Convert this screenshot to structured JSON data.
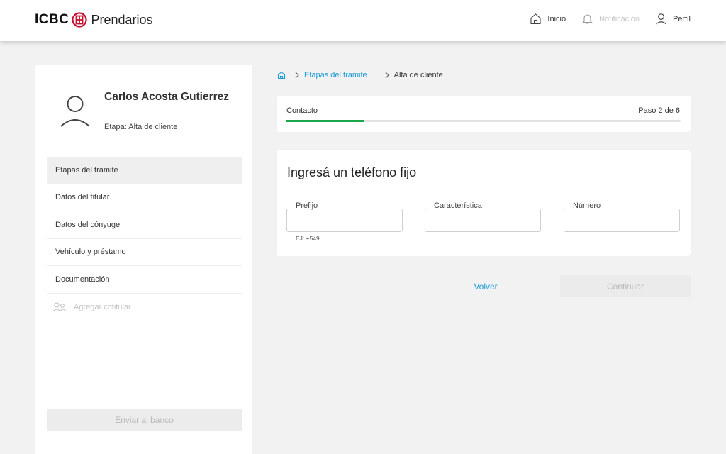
{
  "header": {
    "brand": "ICBC",
    "product": "Prendarios",
    "nav": {
      "home": "Inicio",
      "notifications": "Notificación",
      "profile": "Perfil"
    }
  },
  "sidebar": {
    "user_name": "Carlos Acosta Gutierrez",
    "user_stage": "Etapa: Alta de cliente",
    "items": [
      {
        "label": "Etapas del trámite"
      },
      {
        "label": "Datos del titular"
      },
      {
        "label": "Datos del cónyuge"
      },
      {
        "label": "Vehículo y préstamo"
      },
      {
        "label": "Documentación"
      }
    ],
    "add_cotitular": "Agregar cotitular",
    "send_button": "Enviar al banco"
  },
  "breadcrumb": {
    "link": "Etapas del trámite",
    "current": "Alta de cliente"
  },
  "progress": {
    "label": "Contacto",
    "step_text": "Paso 2 de 6",
    "fraction": 0.2
  },
  "form": {
    "title": "Ingresá un teléfono fijo",
    "fields": {
      "prefix_label": "Prefijo",
      "prefix_value": "",
      "prefix_hint": "EJ: +549",
      "characteristic_label": "Característica",
      "characteristic_value": "",
      "number_label": "Número",
      "number_value": ""
    }
  },
  "actions": {
    "back": "Volver",
    "continue": "Continuar"
  },
  "colors": {
    "accent": "#1b9ad6",
    "progress": "#18a64b",
    "brand_red": "#c8102e"
  }
}
